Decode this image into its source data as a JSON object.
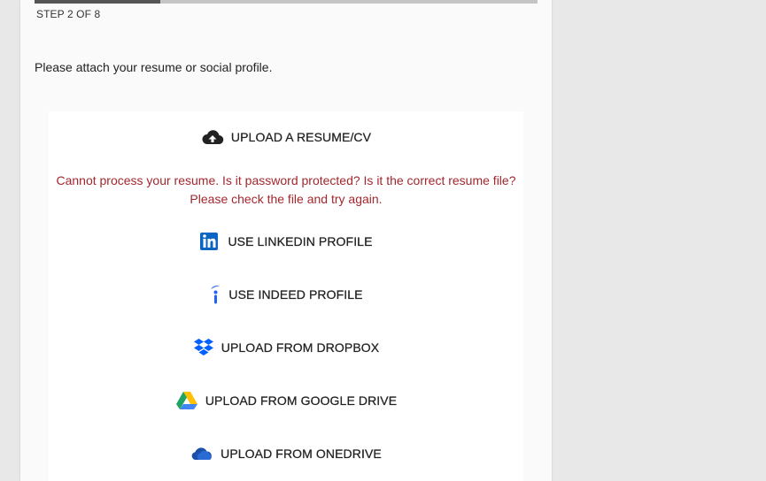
{
  "progress": {
    "step_text": "STEP 2 OF 8",
    "fraction": 0.25,
    "track_color": "#c4c4c4",
    "fill_color": "#555555"
  },
  "prompt": "Please attach your resume or social profile.",
  "options": {
    "upload_resume": {
      "label": "UPLOAD A RESUME/CV",
      "icon": "cloud-upload-icon"
    },
    "linkedin": {
      "label": "USE LINKEDIN PROFILE",
      "icon": "linkedin-icon"
    },
    "indeed": {
      "label": "USE INDEED PROFILE",
      "icon": "indeed-icon"
    },
    "dropbox": {
      "label": "UPLOAD FROM DROPBOX",
      "icon": "dropbox-icon"
    },
    "google_drive": {
      "label": "UPLOAD FROM GOOGLE DRIVE",
      "icon": "google-drive-icon"
    },
    "onedrive": {
      "label": "UPLOAD FROM ONEDRIVE",
      "icon": "onedrive-icon"
    }
  },
  "error": {
    "line1": "Cannot process your resume. Is it password protected? Is it the correct resume file?",
    "line2": "Please check the file and try again.",
    "color": "#a3272d"
  }
}
